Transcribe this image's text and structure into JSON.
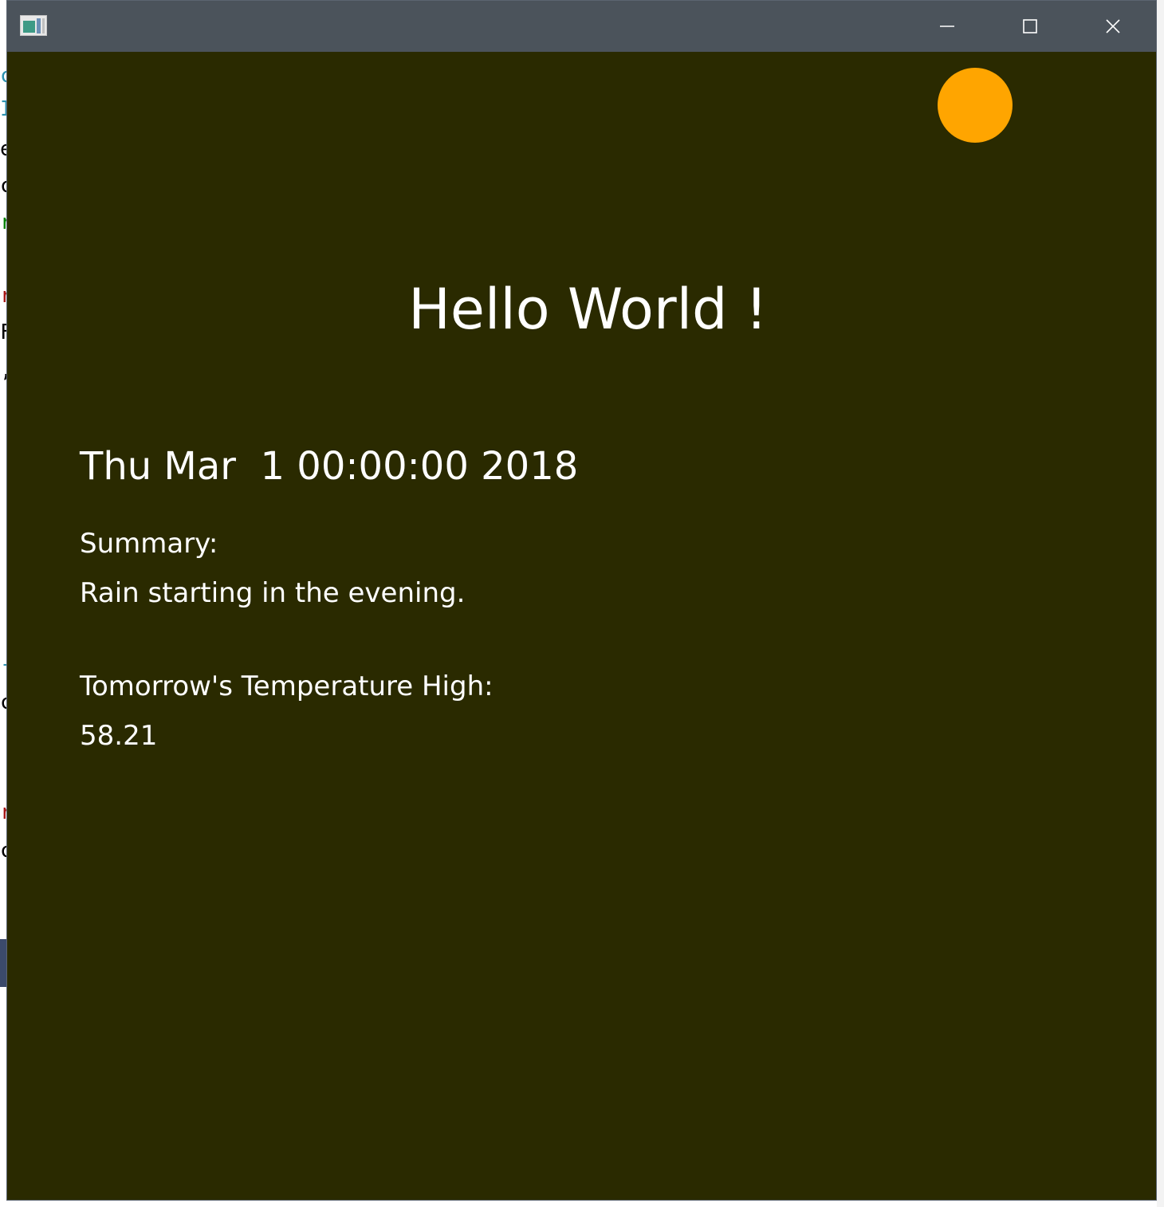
{
  "window": {
    "title": "",
    "controls": {
      "minimize": "minimize",
      "maximize": "maximize",
      "close": "close"
    }
  },
  "background_editor_chars": [
    "c",
    "I",
    "e",
    "c",
    "r",
    "r",
    "F",
    ",",
    "-",
    "c",
    "r",
    "c"
  ],
  "colors": {
    "content_background": "#2a2a00",
    "titlebar": "#4b535b",
    "sun": "#ffa500",
    "text": "#ffffff"
  },
  "main": {
    "heading": "Hello World !",
    "date": "Thu Mar  1 00:00:00 2018",
    "summary_label": "Summary:",
    "summary_text": "Rain starting in the evening.",
    "temperature_label": "Tomorrow's Temperature High:",
    "temperature_value": "58.21",
    "weather_icon": "sun-icon"
  }
}
